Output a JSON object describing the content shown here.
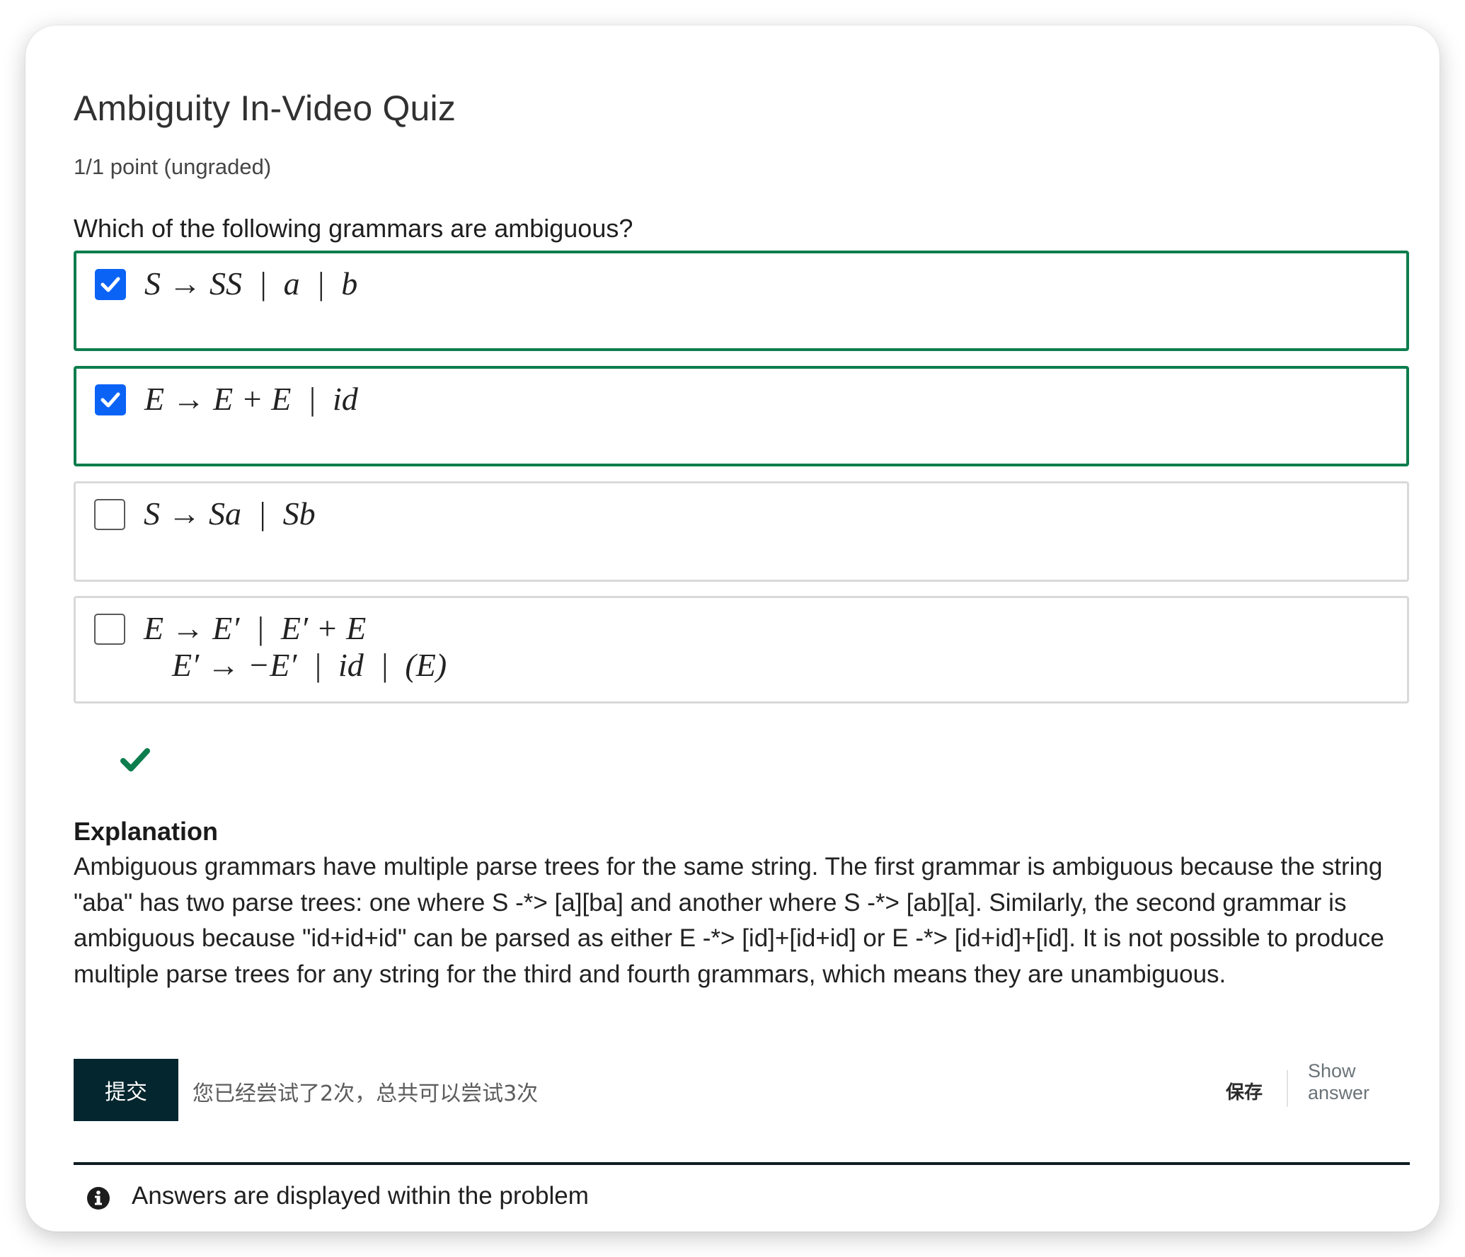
{
  "quiz": {
    "title": "Ambiguity In-Video Quiz",
    "points": "1/1 point (ungraded)",
    "question": "Which of the following grammars are ambiguous?"
  },
  "options": [
    {
      "formula": "S → SS  |  a  |  b",
      "checked": true,
      "correct": true
    },
    {
      "formula": "E → E + E  |  id",
      "checked": true,
      "correct": true
    },
    {
      "formula": "S → Sa  |  Sb",
      "checked": false,
      "correct": false
    },
    {
      "formula": "E → E′  |  E′ + E",
      "formula_line2": "E′ → −E′  |  id  |  (E)",
      "checked": false,
      "correct": false
    }
  ],
  "result": {
    "status": "correct",
    "icon": "checkmark-icon",
    "color": "#0d7d4d"
  },
  "explanation": {
    "title": "Explanation",
    "body": "Ambiguous grammars have multiple parse trees for the same string. The first grammar is ambiguous because the string \"aba\" has two parse trees: one where S -*> [a][ba] and another where S -*> [ab][a]. Similarly, the second grammar is ambiguous because \"id+id+id\" can be parsed as either E -*> [id]+[id+id] or E -*> [id+id]+[id]. It is not possible to produce multiple parse trees for any string for the third and fourth grammars, which means they are unambiguous."
  },
  "actions": {
    "submit_label": "提交",
    "attempts_text": "您已经尝试了2次，总共可以尝试3次",
    "save_label": "保存",
    "show_answer_label": "Show answer"
  },
  "notice": {
    "text": "Answers are displayed within the problem",
    "icon": "info-icon"
  },
  "colors": {
    "correct_border": "#0d7d4d",
    "checkbox_checked": "#0b63f6",
    "submit_bg": "#04262e"
  }
}
